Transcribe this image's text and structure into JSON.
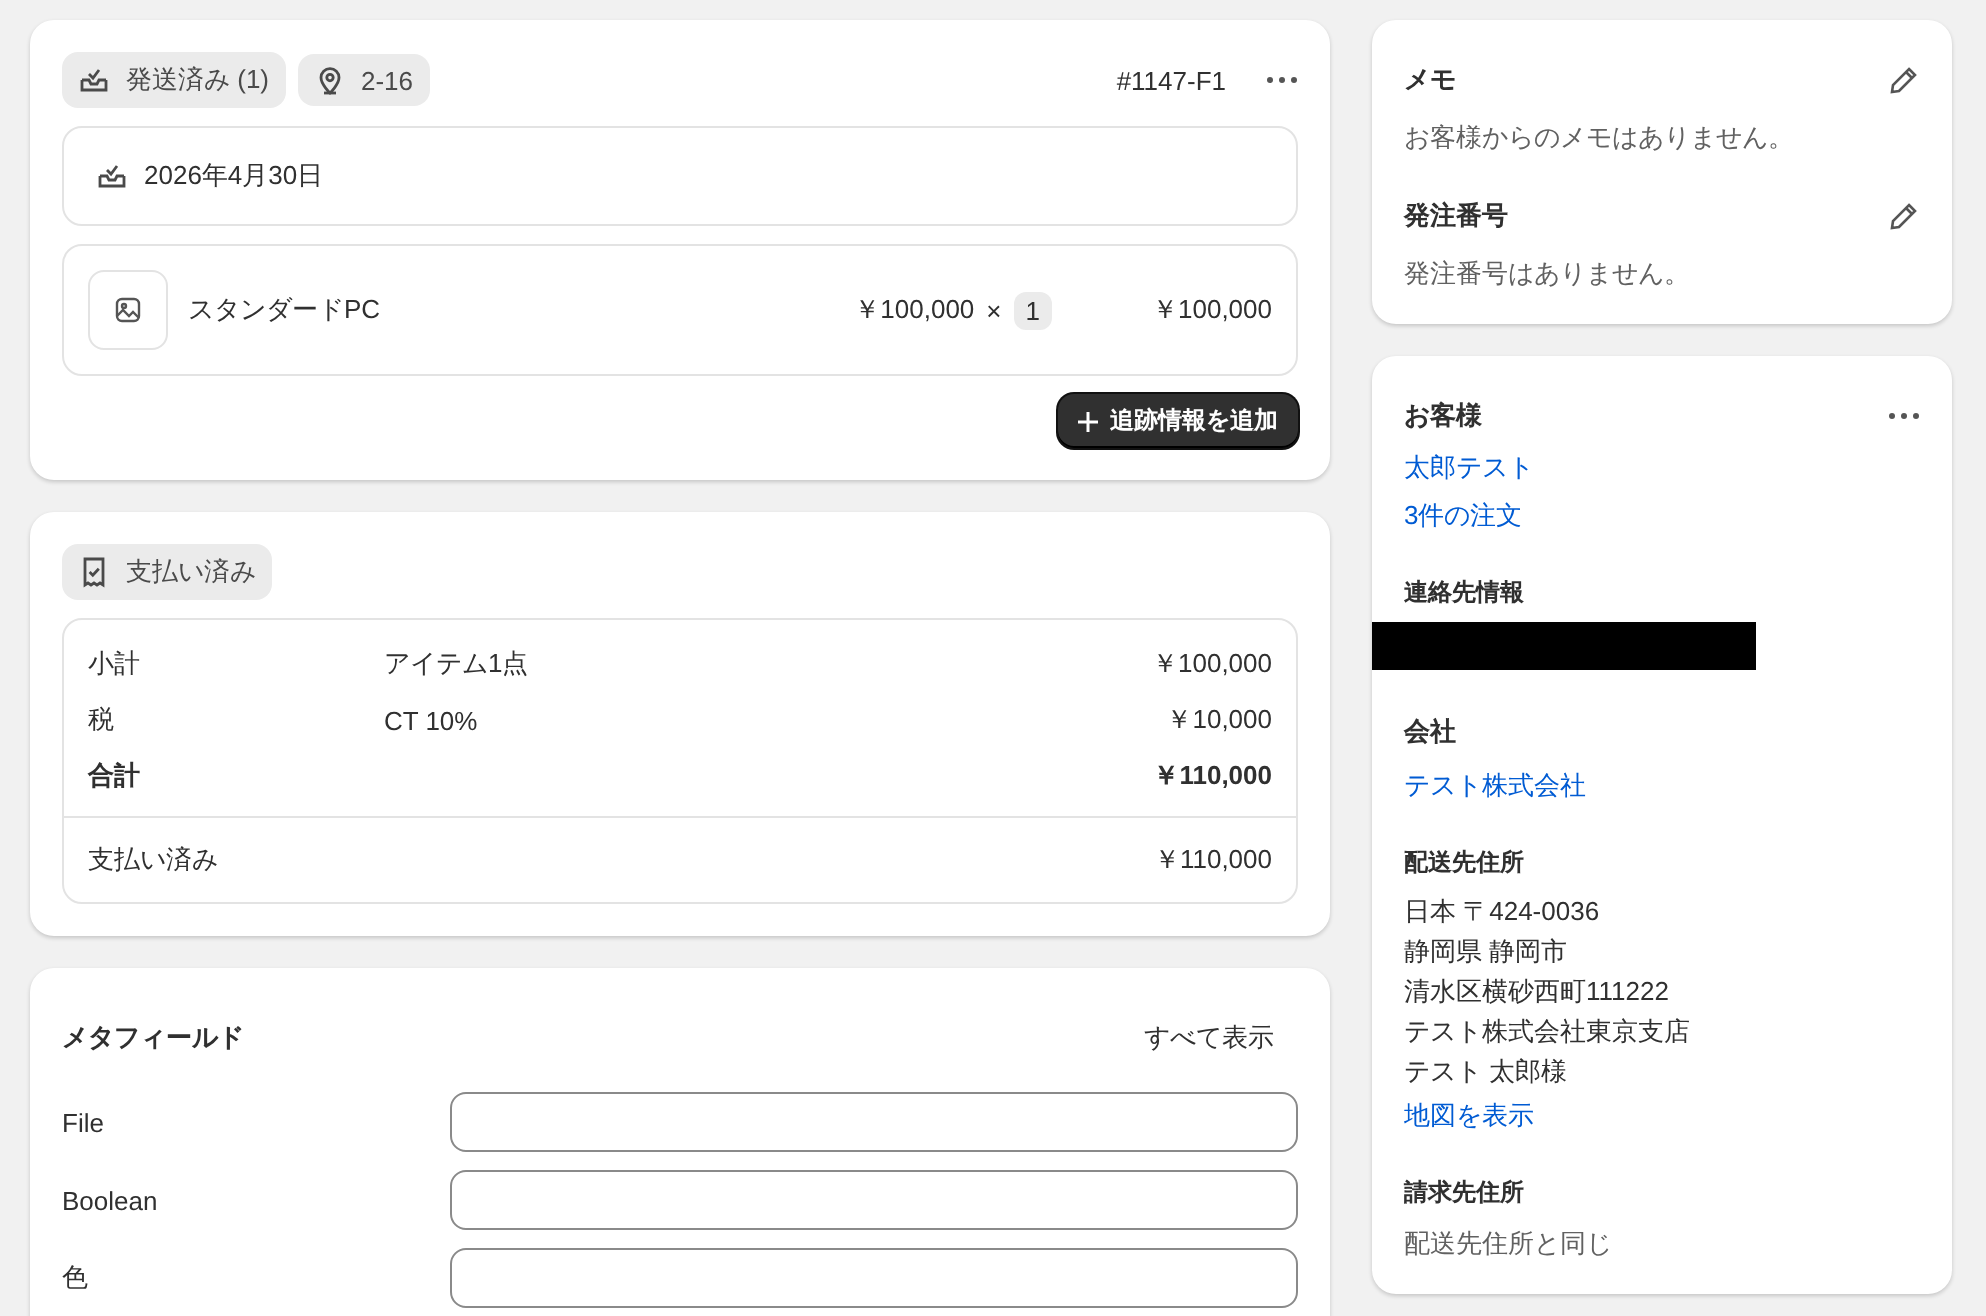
{
  "fulfillment": {
    "badges": [
      {
        "kind": "shipped",
        "label": "発送済み (1)"
      },
      {
        "kind": "location",
        "label": "2-16"
      }
    ],
    "order_number": "#1147-F1",
    "date": "2026年4月30日",
    "item": {
      "name": "スタンダードPC",
      "unit_price": "￥100,000",
      "times": "×",
      "quantity": "1",
      "total": "￥100,000"
    },
    "add_tracking_button": "追跡情報を追加"
  },
  "payment": {
    "badge": "支払い済み",
    "rows": [
      {
        "label": "小計",
        "detail": "アイテム1点",
        "amount": "￥100,000",
        "bold": false
      },
      {
        "label": "税",
        "detail": "CT 10%",
        "amount": "￥10,000",
        "bold": false
      },
      {
        "label": "合計",
        "amount": "￥110,000",
        "bold": true
      }
    ],
    "paid": {
      "label": "支払い済み",
      "amount": "￥110,000"
    }
  },
  "metafields": {
    "title": "メタフィールド",
    "show_all": "すべて表示",
    "fields": [
      {
        "label": "File"
      },
      {
        "label": "Boolean"
      },
      {
        "label": "色"
      }
    ]
  },
  "notes": {
    "sections": [
      {
        "title": "メモ",
        "text": "お客様からのメモはありません。"
      },
      {
        "title": "発注番号",
        "text": "発注番号はありません。"
      }
    ]
  },
  "customer": {
    "title": "お客様",
    "name": "太郎テスト",
    "orders": "3件の注文",
    "contact_title": "連絡先情報",
    "company_title": "会社",
    "company": "テスト株式会社",
    "shipping_title": "配送先住所",
    "shipping_lines": [
      "日本 〒424-0036",
      "静岡県 静岡市",
      "清水区横砂西町111222",
      "テスト株式会社東京支店",
      "テスト 太郎様"
    ],
    "map_link": "地図を表示",
    "billing_title": "請求先住所",
    "billing_text": "配送先住所と同じ"
  }
}
